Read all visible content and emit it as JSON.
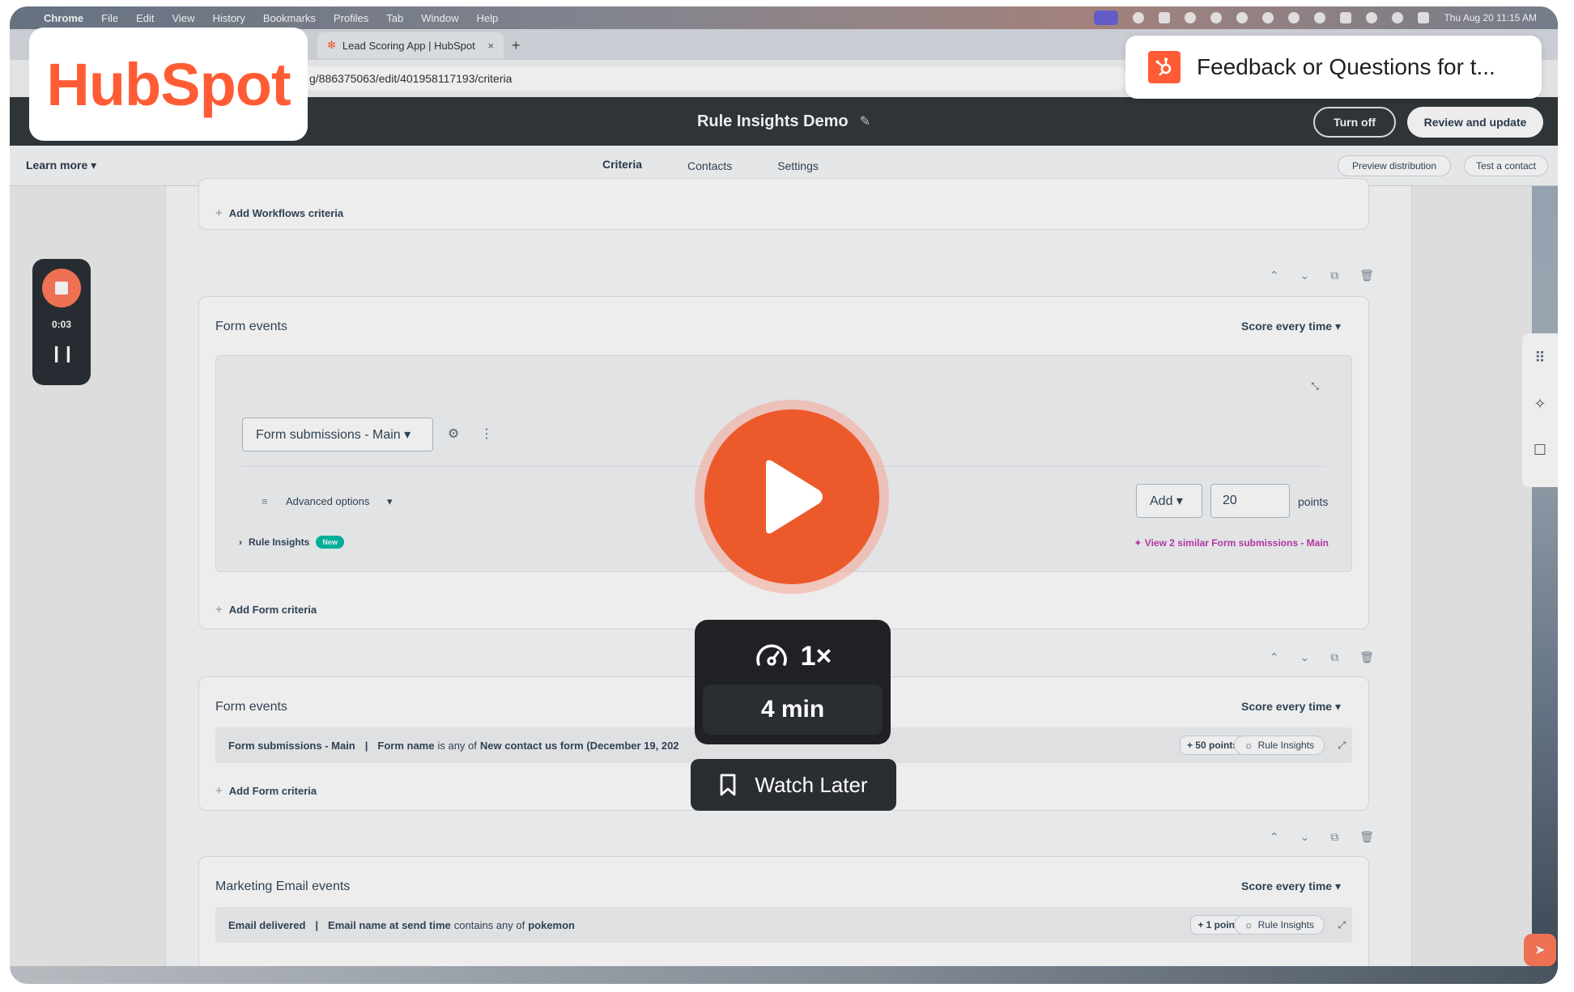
{
  "menubar": {
    "items": [
      "Chrome",
      "File",
      "Edit",
      "View",
      "History",
      "Bookmarks",
      "Profiles",
      "Tab",
      "Window",
      "Help"
    ],
    "clock": "Thu Aug 20  11:15 AM"
  },
  "browser": {
    "tab_title": "Lead Scoring App | HubSpot",
    "tab_close": "×",
    "new_tab": "+",
    "url": "g/886375063/edit/401958117193/criteria"
  },
  "header": {
    "title": "Rule Insights Demo",
    "turn_off": "Turn off",
    "review": "Review and update"
  },
  "subnav": {
    "learn_more": "Learn more ▾",
    "tabs": [
      {
        "label": "Criteria",
        "active": true
      },
      {
        "label": "Contacts",
        "active": false
      },
      {
        "label": "Settings",
        "active": false
      }
    ],
    "preview": "Preview distribution",
    "test": "Test a contact"
  },
  "workflows_card": {
    "add_label": "Add Workflows criteria"
  },
  "form_card_1": {
    "title": "Form events",
    "score": "Score every time ▾",
    "dropdown": "Form submissions - Main ▾",
    "advanced": "Advanced options",
    "rule_insights": "Rule Insights",
    "new_badge": "New",
    "add_select": "Add ▾",
    "points_value": "20",
    "points_label": "points",
    "similar": "✦ View 2 similar Form submissions - Main",
    "add_label": "Add Form criteria"
  },
  "form_card_2": {
    "title": "Form events",
    "score": "Score every time ▾",
    "crit_a": "Form submissions - Main",
    "crit_sep": "|",
    "crit_b": "Form name",
    "crit_c": "is any of",
    "crit_d": "New contact us form (December 19, 202",
    "points": "+ 50 points",
    "rule_insights": "Rule Insights",
    "add_label": "Add Form criteria"
  },
  "email_card": {
    "title": "Marketing Email events",
    "score": "Score every time ▾",
    "crit_a": "Email delivered",
    "crit_sep": "|",
    "crit_b": "Email name at send time",
    "crit_c": "contains any of",
    "crit_d": "pokemon",
    "points": "+ 1 point",
    "rule_insights": "Rule Insights"
  },
  "recorder": {
    "time": "0:03"
  },
  "overlay": {
    "logo": "HubSpot",
    "feedback": "Feedback or Questions for t...",
    "speed": "1×",
    "duration": "4 min",
    "watch_later": "Watch Later"
  },
  "colors": {
    "hubspot_orange": "#ff5c35",
    "play_orange": "#ec5a2c",
    "header_dark": "#33383d"
  }
}
